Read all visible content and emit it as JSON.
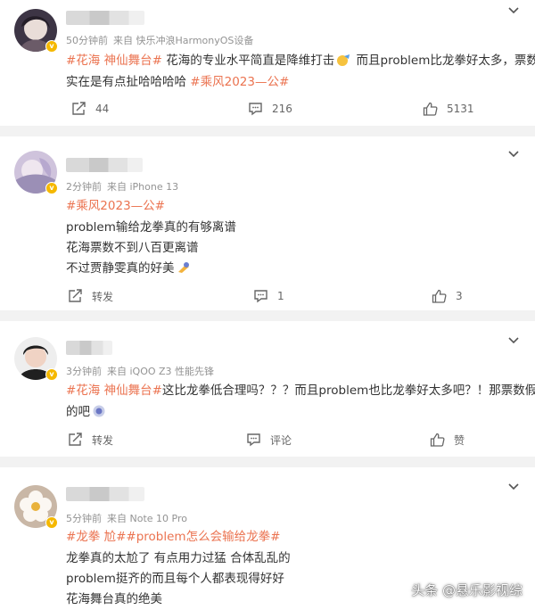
{
  "posts": [
    {
      "time": "50分钟前",
      "source": "来自 快乐冲浪HarmonyOS设备",
      "lines": [
        {
          "tag": "#花海 神仙舞台#",
          "text": " 花海的专业水平简直是降维打击",
          "after": " 而且problem比龙拳好太多，票数"
        },
        {
          "text": "实在是有点扯哈哈哈哈 ",
          "tag2": "#乘风2023—公#"
        }
      ],
      "repost": "44",
      "comment": "216",
      "like": "5131"
    },
    {
      "time": "2分钟前",
      "source": "来自 iPhone 13",
      "lines": [
        {
          "tag": "#乘风2023—公#"
        },
        {
          "text": "problem输给龙拳真的有够离谱"
        },
        {
          "text": "花海票数不到八百更离谱"
        },
        {
          "text": "不过贾静雯真的好美"
        }
      ],
      "repost": "转发",
      "comment": "1",
      "like": "3"
    },
    {
      "time": "3分钟前",
      "source": "来自 iQOO Z3 性能先锋",
      "lines": [
        {
          "tag": "#花海 神仙舞台#",
          "text": "这比龙拳低合理吗？？？而且problem也比龙拳好太多吧？！那票数假"
        },
        {
          "text": "的吧"
        }
      ],
      "repost": "转发",
      "comment": "评论",
      "like": "赞"
    },
    {
      "time": "5分钟前",
      "source": "来自 Note 10 Pro",
      "lines": [
        {
          "tag": "#龙拳 尬##problem怎么会输给龙拳#"
        },
        {
          "text": "龙拳真的太尬了 有点用力过猛 合体乱乱的"
        },
        {
          "text": "problem挺齐的而且每个人都表现得好好"
        },
        {
          "text": "花海舞台真的绝美"
        }
      ]
    }
  ],
  "watermark": "头条 @悬乐影视综",
  "colors": {
    "accent": "#eb7350",
    "meta": "#939393",
    "divider": "#f2f2f2"
  }
}
